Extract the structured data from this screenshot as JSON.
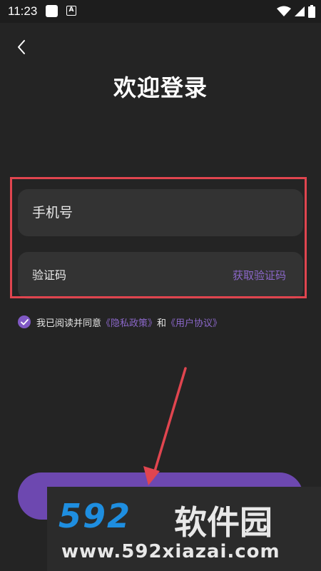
{
  "status_bar": {
    "time": "11:23",
    "icons": [
      "notification-square-icon",
      "a-keyboard-icon",
      "wifi-icon",
      "signal-icon",
      "battery-icon"
    ]
  },
  "header": {
    "back_icon": "chevron-left-icon",
    "title": "欢迎登录"
  },
  "form": {
    "phone_placeholder": "手机号",
    "code_placeholder": "验证码",
    "get_code_label": "获取验证码"
  },
  "agreement": {
    "prefix": "我已阅读并同意",
    "privacy_link": "《隐私政策》",
    "and": "和",
    "terms_link": "《用户协议》",
    "checked": true
  },
  "colors": {
    "background": "#242424",
    "field": "#333333",
    "accent": "#8b67c9",
    "button": "#6d48b0",
    "annotation_red": "#e0454f"
  },
  "watermark": {
    "logo_number": "592",
    "logo_text": "软件园",
    "url": "www.592xiazai.com"
  }
}
